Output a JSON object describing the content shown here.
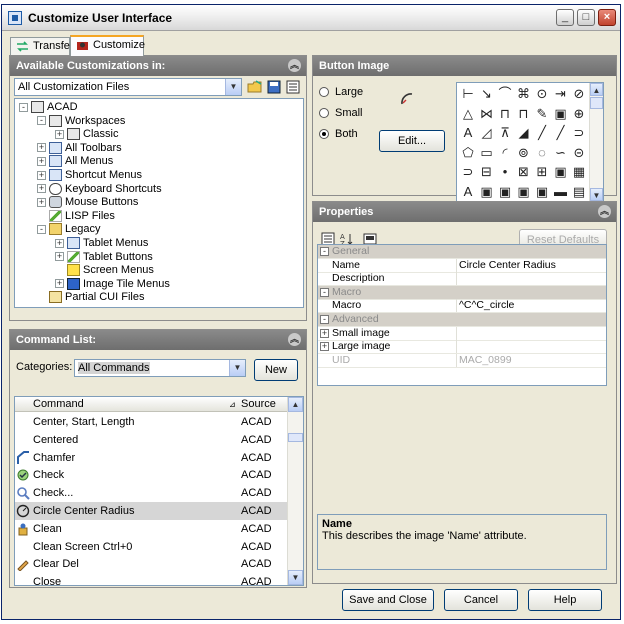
{
  "window": {
    "title": "Customize User Interface",
    "min_glyph": "_",
    "max_glyph": "□",
    "close_glyph": "×"
  },
  "tabs": [
    {
      "label": "Transfer"
    },
    {
      "label": "Customize"
    }
  ],
  "available": {
    "header": "Available Customizations in:",
    "filter_value": "All Customization Files",
    "tree": [
      {
        "label": "ACAD",
        "level": 0,
        "expander": "-",
        "icon": "book"
      },
      {
        "label": "Workspaces",
        "level": 1,
        "expander": "-",
        "icon": "book"
      },
      {
        "label": "Classic",
        "level": 2,
        "expander": "+",
        "icon": "book"
      },
      {
        "label": "All Toolbars",
        "level": 1,
        "expander": "+",
        "icon": "tb"
      },
      {
        "label": "All Menus",
        "level": 1,
        "expander": "+",
        "icon": "tb"
      },
      {
        "label": "Shortcut Menus",
        "level": 1,
        "expander": "+",
        "icon": "tb"
      },
      {
        "label": "Keyboard Shortcuts",
        "level": 1,
        "expander": "+",
        "icon": "kbd"
      },
      {
        "label": "Mouse Buttons",
        "level": 1,
        "expander": "+",
        "icon": "mouse"
      },
      {
        "label": "LISP Files",
        "level": 1,
        "expander": "",
        "icon": "pen"
      },
      {
        "label": "Legacy",
        "level": 1,
        "expander": "-",
        "icon": "folder"
      },
      {
        "label": "Tablet Menus",
        "level": 2,
        "expander": "+",
        "icon": "tb"
      },
      {
        "label": "Tablet Buttons",
        "level": 2,
        "expander": "+",
        "icon": "pen"
      },
      {
        "label": "Screen Menus",
        "level": 2,
        "expander": "",
        "icon": "screen"
      },
      {
        "label": "Image Tile Menus",
        "level": 2,
        "expander": "+",
        "icon": "image"
      },
      {
        "label": "Partial CUI Files",
        "level": 1,
        "expander": "",
        "icon": "cui"
      }
    ]
  },
  "command_list": {
    "header": "Command List:",
    "categories_label": "Categories:",
    "categories_value": "All Commands",
    "new_label": "New",
    "col_command": "Command",
    "col_source": "Source",
    "rows": [
      {
        "name": "Center, Start, Length",
        "source": "ACAD",
        "icon": ""
      },
      {
        "name": "Centered",
        "source": "ACAD",
        "icon": ""
      },
      {
        "name": "Chamfer",
        "source": "ACAD",
        "icon": "chamfer"
      },
      {
        "name": "Check",
        "source": "ACAD",
        "icon": "check"
      },
      {
        "name": "Check...",
        "source": "ACAD",
        "icon": "check-dots"
      },
      {
        "name": "Circle Center Radius",
        "source": "ACAD",
        "icon": "circle",
        "selected": true
      },
      {
        "name": "Clean",
        "source": "ACAD",
        "icon": "clean"
      },
      {
        "name": "Clean Screen   Ctrl+0",
        "source": "ACAD",
        "icon": ""
      },
      {
        "name": "Clear   Del",
        "source": "ACAD",
        "icon": "clear"
      },
      {
        "name": "Close",
        "source": "ACAD",
        "icon": ""
      }
    ]
  },
  "button_image": {
    "header": "Button Image",
    "radio_large": "Large",
    "radio_small": "Small",
    "radio_both": "Both",
    "selected": "Both",
    "edit_label": "Edit..."
  },
  "properties": {
    "header": "Properties",
    "reset_label": "Reset Defaults",
    "rows": [
      {
        "type": "cat",
        "key": "General",
        "exp": "-"
      },
      {
        "type": "row",
        "key": "Name",
        "value": "Circle Center Radius"
      },
      {
        "type": "row",
        "key": "Description",
        "value": ""
      },
      {
        "type": "cat",
        "key": "Macro",
        "exp": "-"
      },
      {
        "type": "row",
        "key": "Macro",
        "value": "^C^C_circle"
      },
      {
        "type": "cat",
        "key": "Advanced",
        "exp": "-"
      },
      {
        "type": "row",
        "key": "Small image",
        "value": "",
        "exp": "+"
      },
      {
        "type": "row",
        "key": "Large image",
        "value": "",
        "exp": "+"
      },
      {
        "type": "row",
        "key": "UID",
        "value": "MAC_0899",
        "disabled": true
      }
    ],
    "desc_title": "Name",
    "desc_text": "This describes the image 'Name' attribute."
  },
  "footer": {
    "save_label": "Save and Close",
    "cancel_label": "Cancel",
    "help_label": "Help"
  }
}
